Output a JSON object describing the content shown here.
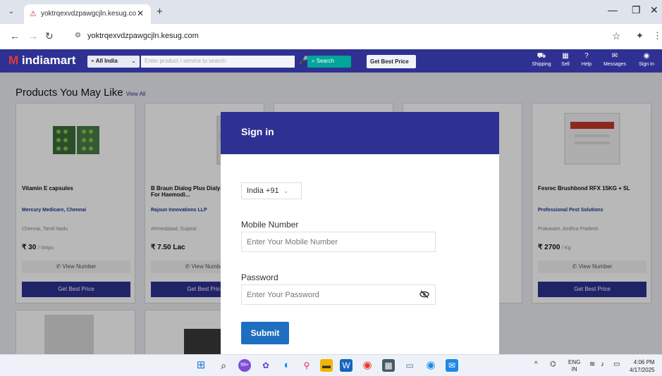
{
  "browser": {
    "tab": {
      "title": "yoktrqexvdzpawgcjln.kesug.com",
      "favicon": "site-warning-icon"
    },
    "url": "yoktrqexvdzpawgcjln.kesug.com"
  },
  "header": {
    "logo": "indiamart",
    "location": "All India",
    "search_placeholder": "Enter product / service to search",
    "search_label": "Search",
    "best_price": "Get Best Price",
    "nav": [
      {
        "label": "Shipping",
        "icon": "truck-icon"
      },
      {
        "label": "Sell",
        "icon": "store-icon"
      },
      {
        "label": "Help",
        "icon": "help-icon"
      },
      {
        "label": "Messages",
        "icon": "messages-icon"
      },
      {
        "label": "Sign In",
        "icon": "user-icon"
      }
    ]
  },
  "section": {
    "title": "Products You May Like",
    "view_all": "View All"
  },
  "products": [
    {
      "name": "Vitamin E capsules",
      "seller": "Mercury Medicare, Chennai",
      "city": "Chennai, Tamil Nadu",
      "price": "₹ 30",
      "unit": "/ Strips",
      "view": "View Number",
      "cta": "Get Best Price"
    },
    {
      "name": "B Braun Dialog Plus Dialysis Machine, For Haemodi...",
      "seller": "Rajsun Innovations LLP",
      "city": "Ahmedabad, Gujarat",
      "price": "₹ 7.50 Lac",
      "unit": "",
      "view": "View Number",
      "cta": "Get Best Price"
    },
    {
      "name": "",
      "seller": "",
      "city": "",
      "price": "",
      "unit": "",
      "view": "",
      "cta": ""
    },
    {
      "name": "",
      "seller": "",
      "city": "",
      "price": "",
      "unit": "",
      "view": "",
      "cta": ""
    },
    {
      "name": "Fesrec Brushbond RFX 15KG + 5L",
      "seller": "Professional Pest Solutions",
      "city": "Prakasam, Andhra Pradesh",
      "price": "₹ 2700",
      "unit": "/ Kg",
      "view": "View Number",
      "cta": "Get Best Price"
    }
  ],
  "modal": {
    "title": "Sign in",
    "country": "India +91",
    "mobile_label": "Mobile Number",
    "mobile_placeholder": "Enter Your Mobile Number",
    "password_label": "Password",
    "password_placeholder": "Enter Your Password",
    "submit": "Submit"
  },
  "taskbar": {
    "badge": "99+",
    "lang_top": "ENG",
    "lang_bottom": "IN",
    "time": "4:06 PM",
    "date": "4/17/2025"
  },
  "colors": {
    "brand": "#2e3192",
    "submit": "#1e6fbf",
    "accent_red": "#e53935",
    "search_green": "#00a699"
  }
}
